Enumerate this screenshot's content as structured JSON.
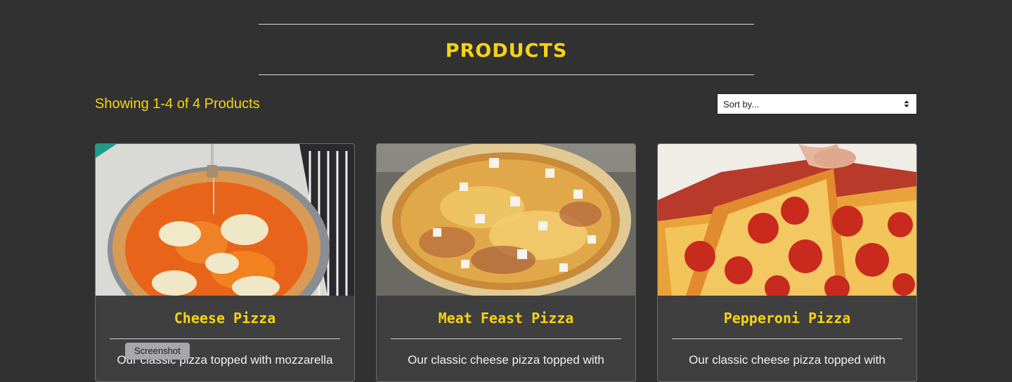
{
  "header": {
    "title": "PRODUCTS"
  },
  "toolbar": {
    "showing_text": "Showing 1-4 of 4 Products",
    "sort_label": "Sort by..."
  },
  "products": [
    {
      "name": "Cheese Pizza",
      "description": "Our classic pizza topped with mozzarella",
      "image_icon": "cheese-pizza-image"
    },
    {
      "name": "Meat Feast Pizza",
      "description": "Our classic cheese pizza topped with",
      "image_icon": "meat-feast-pizza-image"
    },
    {
      "name": "Pepperoni Pizza",
      "description": "Our classic cheese pizza topped with",
      "image_icon": "pepperoni-pizza-image"
    }
  ],
  "overlay": {
    "tooltip": "Screenshot"
  },
  "colors": {
    "accent": "#f5d316",
    "background": "#313131",
    "card": "#3f3f3f"
  }
}
